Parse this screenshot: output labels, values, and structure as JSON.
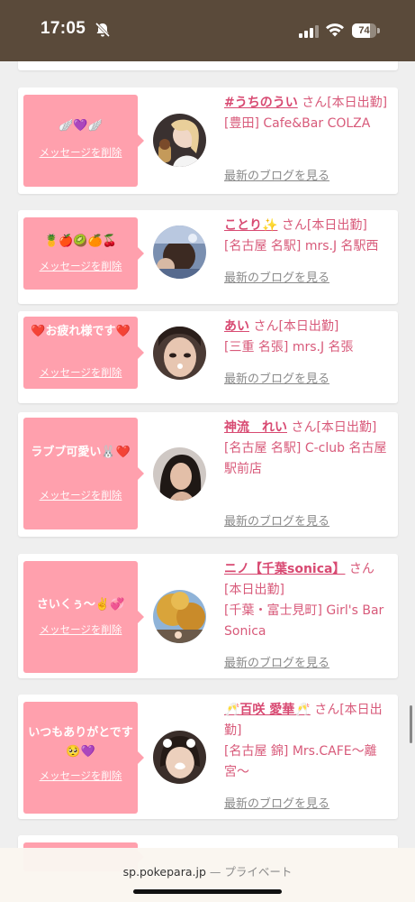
{
  "status": {
    "time": "17:05",
    "battery": "74",
    "battery_level": 0.74
  },
  "common": {
    "delete_label": "メッセージを削除",
    "blog_label": "最新のブログを見る",
    "san": "さん"
  },
  "cards": [
    {
      "message": "🪽💜🪽",
      "name": "#うちのうい",
      "status": "[本日出勤]",
      "shop": "[豊田] Cafe&Bar COLZA"
    },
    {
      "message": "🍍🍎🥝🍊🍒",
      "name": "ことり✨",
      "status": "[本日出勤]",
      "shop": "[名古屋 名駅] mrs.J 名駅西"
    },
    {
      "message": "❤️お疲れ様です❤️",
      "name": "あい",
      "status": "[本日出勤]",
      "shop": "[三重 名張] mrs.J 名張"
    },
    {
      "message": "ラブブ可愛い🐰❤️",
      "name": "神流　れい",
      "status": "[本日出勤]",
      "shop": "[名古屋 名駅] C-club 名古屋駅前店"
    },
    {
      "message": "さいくぅ〜✌️💞",
      "name": "ニノ【千葉sonica】",
      "status": "[本日出勤]",
      "shop": "[千葉・富士見町] Girl's Bar Sonica"
    },
    {
      "message": "いつもありがとです🥺💜",
      "name": "🥂百咲 愛華🥂",
      "status": "[本日出勤]",
      "shop": "[名古屋 錦] Mrs.CAFE〜離宮〜"
    }
  ],
  "browser": {
    "domain": "sp.pokepara.jp",
    "private_label": "— プライベート"
  }
}
